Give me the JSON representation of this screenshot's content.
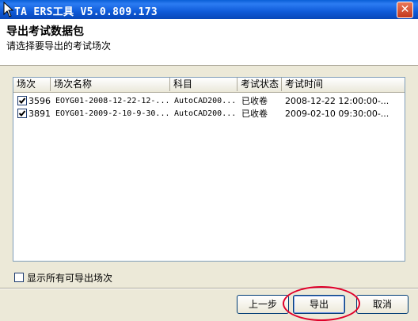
{
  "window": {
    "title": "TA ERS工具 V5.0.809.173",
    "close_label": "✕"
  },
  "header": {
    "title": "导出考试数据包",
    "subtitle": "请选择要导出的考试场次"
  },
  "table": {
    "columns": [
      "场次",
      "场次名称",
      "科目",
      "考试状态",
      "考试时间"
    ],
    "rows": [
      {
        "checked": true,
        "id": "3596",
        "name": "EOYG01-2008-12-22-12-...",
        "subject": "AutoCAD200...",
        "status": "已收卷",
        "time": "2008-12-22 12:00:00-..."
      },
      {
        "checked": true,
        "id": "3891",
        "name": "EOYG01-2009-2-10-9-30...",
        "subject": "AutoCAD200...",
        "status": "已收卷",
        "time": "2009-02-10 09:30:00-..."
      }
    ]
  },
  "options": {
    "show_all_label": "显示所有可导出场次",
    "show_all_checked": false
  },
  "buttons": {
    "back": "上一步",
    "export": "导出",
    "cancel": "取消"
  },
  "colors": {
    "highlight_ring": "#e0002a",
    "titlebar": "#0a5fd6"
  }
}
